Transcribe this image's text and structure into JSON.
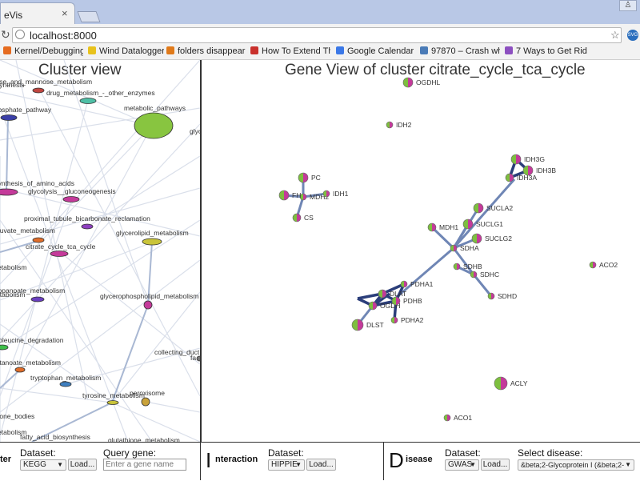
{
  "browser": {
    "tab_title": "eVis",
    "tab_close": "×",
    "url": "localhost:8000",
    "bookmarks": [
      {
        "label": "Kernel/Debugging",
        "color": "#e56b1f"
      },
      {
        "label": "Wind Datalogger",
        "color": "#e8c21c"
      },
      {
        "label": "folders disappear",
        "color": "#e07a1a"
      },
      {
        "label": "How To Extend Th",
        "color": "#c9302c"
      },
      {
        "label": "Google Calendar -",
        "color": "#3b78e7"
      },
      {
        "label": "97870 – Crash wh",
        "color": "#4a7bb7"
      },
      {
        "label": "7 Ways to Get Rid",
        "color": "#8c4fc0"
      }
    ]
  },
  "cluster_view": {
    "title": "Cluster view",
    "labels": [
      "fructose_and_mannose_metabolism",
      "synthesis",
      "drug_metabolism_-_other_enzymes",
      "phosphate_pathway",
      "metabolic_pathways",
      "glyc",
      "biosynthesis_of_amino_acids",
      "glycolysis__gluconeogenesis",
      "proximal_tubule_bicarbonate_reclamation",
      "pyruvate_metabolism",
      "glycerolipid_metabolism",
      "citrate_cycle_tca_cycle",
      "metabolism",
      "propanoate_metabolism",
      "glycerophospholipid_metabolism",
      "metabolism",
      "isoleucine_degradation",
      "collecting_duct",
      "fa",
      "butanoate_metabolism",
      "tryptophan_metabolism",
      "peroxisome",
      "tyrosine_metabolism",
      "ketone_bodies",
      "metabolism",
      "fatty_acid_biosynthesis",
      "glutathione_metabolism"
    ]
  },
  "gene_view": {
    "title": "Gene View of cluster citrate_cycle_tca_cycle",
    "genes": [
      "OGDHL",
      "IDH2",
      "PC",
      "MDH2",
      "IDH1",
      "FH",
      "CS",
      "IDH3G",
      "IDH3B",
      "IDH3A",
      "SUCLA2",
      "SUCLG1",
      "MDH1",
      "SUCLG2",
      "SDHA",
      "SDHB",
      "SDHC",
      "SDHD",
      "ACO2",
      "PDHA1",
      "DLAT",
      "OGDH",
      "PDHB",
      "DLST",
      "PDHA2",
      "ACLY",
      "ACO1"
    ]
  },
  "controls": {
    "cluster": {
      "partial_label": "ter",
      "dataset_label": "Dataset:",
      "dataset_value": "KEGG",
      "load_label": "Load...",
      "query_label": "Query gene:",
      "query_placeholder": "Enter a gene name"
    },
    "interaction": {
      "big_letter": "I",
      "name": "nteraction",
      "dataset_label": "Dataset:",
      "dataset_value": "HIPPIE",
      "load_label": "Load..."
    },
    "disease": {
      "big_letter": "D",
      "name": "isease",
      "dataset_label": "Dataset:",
      "dataset_value": "GWAS",
      "load_label": "Load...",
      "select_label": "Select disease:",
      "select_value": "&beta;2-Glycoprotein I (&beta;2-"
    }
  },
  "colors": {
    "edge_dark": "#2b3e7a",
    "edge_light": "#6f86b5",
    "metabolic_node": "#88c540",
    "node_magenta": "#c43a9a",
    "node_green": "#7dbf3f"
  }
}
